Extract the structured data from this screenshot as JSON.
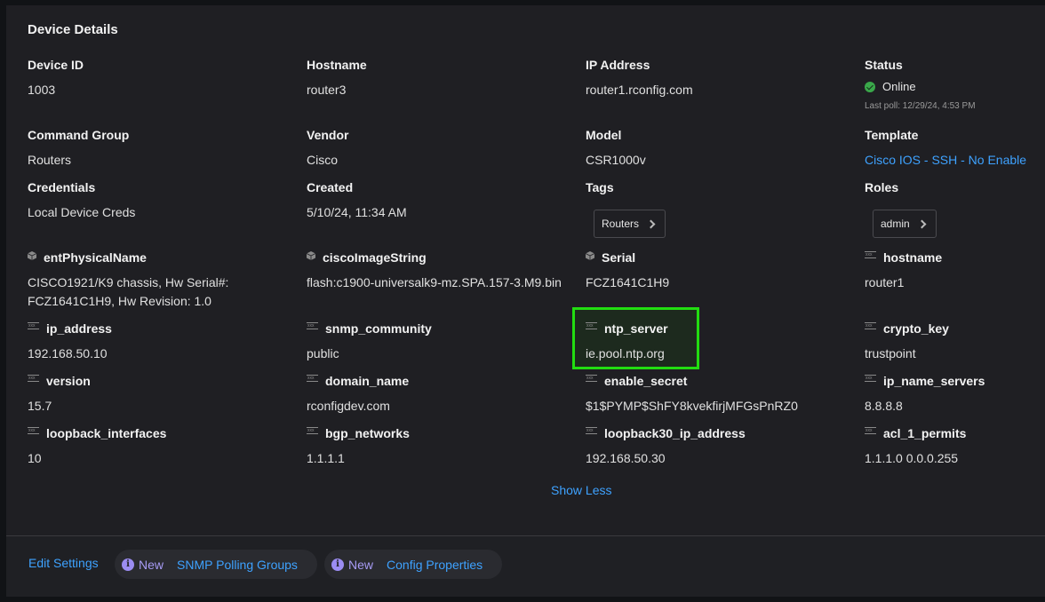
{
  "panel": {
    "title": "Device Details"
  },
  "fields": {
    "device_id": {
      "label": "Device ID",
      "value": "1003"
    },
    "hostname": {
      "label": "Hostname",
      "value": "router3"
    },
    "ip_address": {
      "label": "IP Address",
      "value": "router1.rconfig.com"
    },
    "status": {
      "label": "Status",
      "value": "Online",
      "last_poll": "Last poll: 12/29/24, 4:53 PM",
      "color": "#3aa84a"
    },
    "command_group": {
      "label": "Command Group",
      "value": "Routers"
    },
    "vendor": {
      "label": "Vendor",
      "value": "Cisco"
    },
    "model": {
      "label": "Model",
      "value": "CSR1000v"
    },
    "template": {
      "label": "Template",
      "value": "Cisco IOS - SSH - No Enable"
    },
    "credentials": {
      "label": "Credentials",
      "value": "Local Device Creds"
    },
    "created": {
      "label": "Created",
      "value": "5/10/24, 11:34 AM"
    },
    "tags": {
      "label": "Tags",
      "chip": "Routers"
    },
    "roles": {
      "label": "Roles",
      "chip": "admin"
    }
  },
  "snmp_properties": [
    {
      "label": "entPhysicalName",
      "value": "CISCO1921/K9 chassis, Hw Serial#: FCZ1641C1H9, Hw Revision: 1.0",
      "icon": "cube-icon"
    },
    {
      "label": "ciscoImageString",
      "value": "flash:c1900-universalk9-mz.SPA.157-3.M9.bin",
      "icon": "cube-icon"
    },
    {
      "label": "Serial",
      "value": "FCZ1641C1H9",
      "icon": "cube-icon"
    }
  ],
  "config_properties": [
    {
      "label": "hostname",
      "value": "router1",
      "icon": "text-field-icon"
    },
    {
      "label": "ip_address",
      "value": "192.168.50.10",
      "icon": "text-field-icon"
    },
    {
      "label": "snmp_community",
      "value": "public",
      "icon": "text-field-icon"
    },
    {
      "label": "ntp_server",
      "value": "ie.pool.ntp.org",
      "icon": "text-field-icon",
      "highlighted": true
    },
    {
      "label": "crypto_key",
      "value": "trustpoint",
      "icon": "text-field-icon"
    },
    {
      "label": "version",
      "value": "15.7",
      "icon": "text-field-icon"
    },
    {
      "label": "domain_name",
      "value": "rconfigdev.com",
      "icon": "text-field-icon"
    },
    {
      "label": "enable_secret",
      "value": "$1$PYMP$ShFY8kvekfirjMFGsPnRZ0",
      "icon": "text-field-icon"
    },
    {
      "label": "ip_name_servers",
      "value": "8.8.8.8",
      "icon": "text-field-icon"
    },
    {
      "label": "loopback_interfaces",
      "value": "10",
      "icon": "text-field-icon"
    },
    {
      "label": "bgp_networks",
      "value": "1.1.1.1",
      "icon": "text-field-icon"
    },
    {
      "label": "loopback30_ip_address",
      "value": "192.168.50.30",
      "icon": "text-field-icon"
    },
    {
      "label": "acl_1_permits",
      "value": "1.1.1.0 0.0.0.255",
      "icon": "text-field-icon"
    }
  ],
  "icon_text": "xxx",
  "show_less": "Show Less",
  "footer": {
    "edit_settings": "Edit Settings",
    "pills": [
      {
        "badge": "New",
        "link": "SNMP Polling Groups"
      },
      {
        "badge": "New",
        "link": "Config Properties"
      }
    ],
    "info_glyph": "i"
  },
  "colors": {
    "link": "#3ea2ff",
    "highlight_border": "#22dd11",
    "new_badge": "#a79bf5"
  }
}
